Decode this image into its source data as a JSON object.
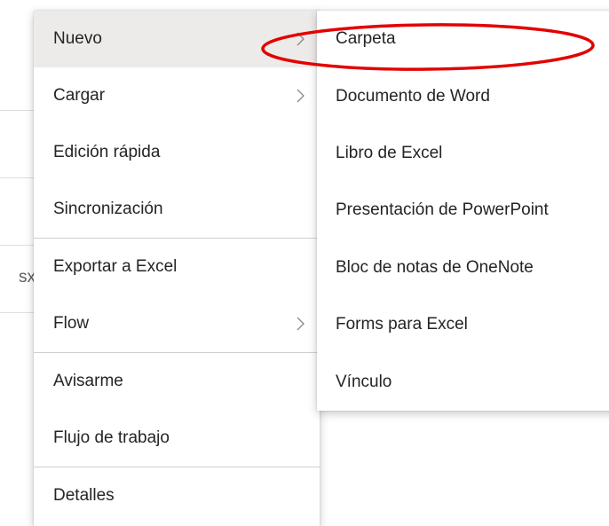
{
  "background": {
    "partial_text": "sx"
  },
  "menu": {
    "items": [
      {
        "label": "Nuevo",
        "has_submenu": true,
        "selected": true
      },
      {
        "label": "Cargar",
        "has_submenu": true
      },
      {
        "label": "Edición rápida",
        "has_submenu": false
      },
      {
        "label": "Sincronización",
        "has_submenu": false
      },
      {
        "label": "Exportar a Excel",
        "has_submenu": false
      },
      {
        "label": "Flow",
        "has_submenu": true
      },
      {
        "label": "Avisarme",
        "has_submenu": false
      },
      {
        "label": "Flujo de trabajo",
        "has_submenu": false
      },
      {
        "label": "Detalles",
        "has_submenu": false
      }
    ]
  },
  "submenu": {
    "items": [
      {
        "label": "Carpeta"
      },
      {
        "label": "Documento de Word"
      },
      {
        "label": "Libro de Excel"
      },
      {
        "label": "Presentación de PowerPoint"
      },
      {
        "label": "Bloc de notas de OneNote"
      },
      {
        "label": "Forms para Excel"
      },
      {
        "label": "Vínculo"
      }
    ]
  },
  "annotation": {
    "color": "#e30000",
    "shape": "ellipse",
    "target": "Carpeta"
  }
}
